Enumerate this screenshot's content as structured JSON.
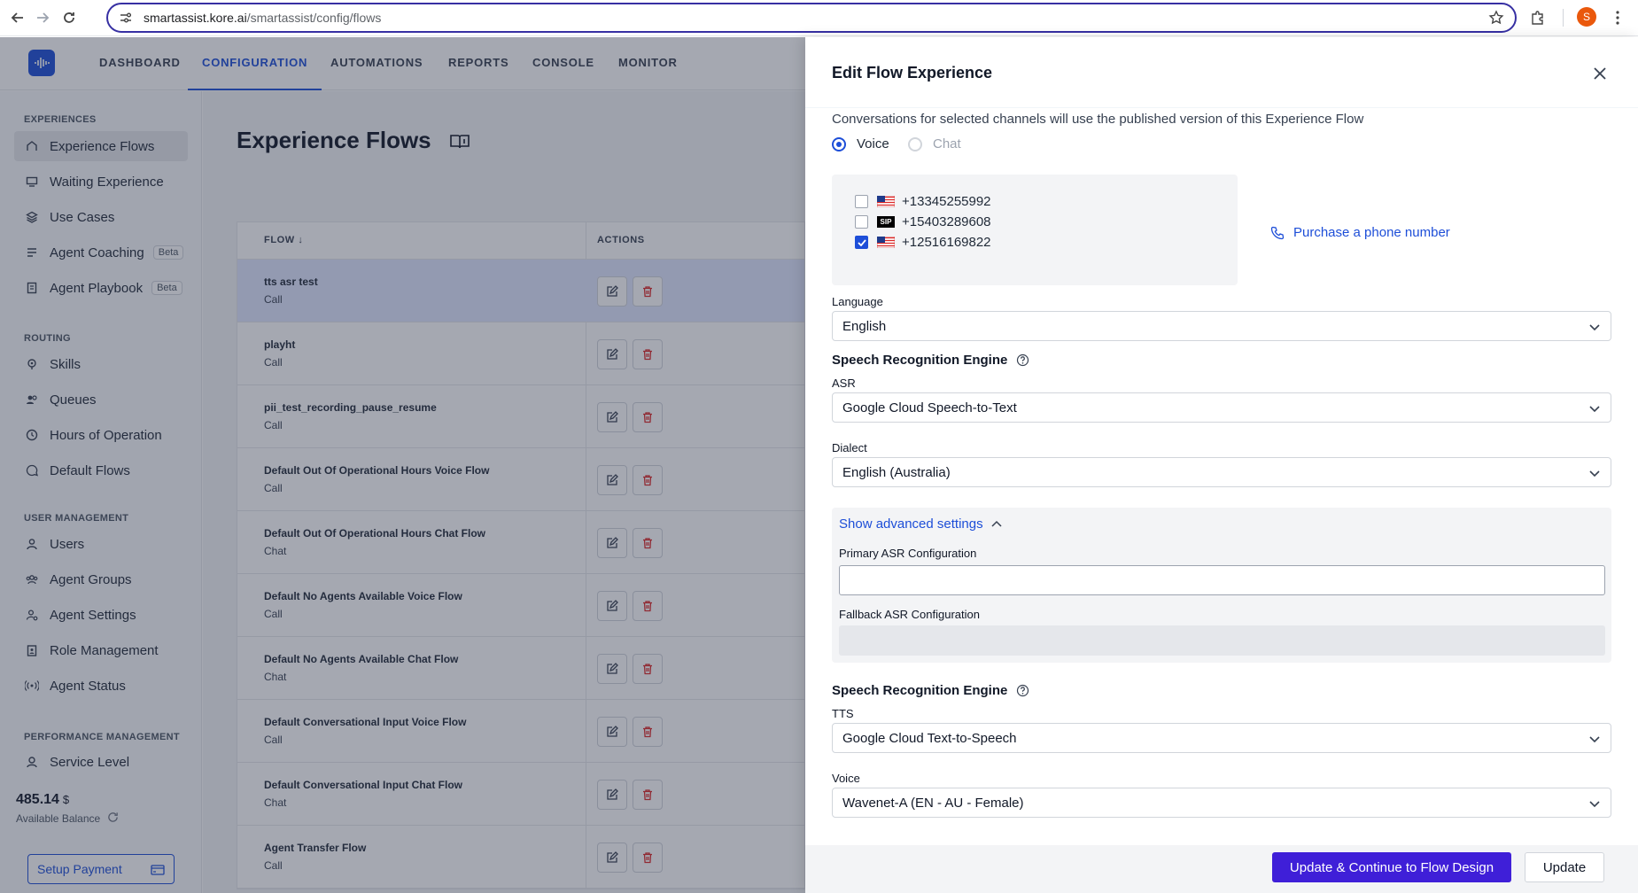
{
  "browser": {
    "url_host": "smartassist.kore.ai",
    "url_path": "/smartassist/config/flows",
    "profile_initial": "S"
  },
  "nav": {
    "items": [
      "DASHBOARD",
      "CONFIGURATION",
      "AUTOMATIONS",
      "REPORTS",
      "CONSOLE",
      "MONITOR"
    ],
    "active": "CONFIGURATION"
  },
  "sidebar": {
    "sections": {
      "experiences": "EXPERIENCES",
      "routing": "ROUTING",
      "user_management": "USER MANAGEMENT",
      "performance_management": "PERFORMANCE MANAGEMENT"
    },
    "items": [
      {
        "label": "Experience Flows",
        "icon": "flow-icon",
        "active": true
      },
      {
        "label": "Waiting Experience",
        "icon": "monitor-icon"
      },
      {
        "label": "Use Cases",
        "icon": "layers-icon"
      },
      {
        "label": "Agent Coaching",
        "icon": "coaching-icon",
        "badge": "Beta"
      },
      {
        "label": "Agent Playbook",
        "icon": "playbook-icon",
        "badge": "Beta"
      },
      {
        "label": "Skills",
        "icon": "pin-icon"
      },
      {
        "label": "Queues",
        "icon": "users-icon"
      },
      {
        "label": "Hours of Operation",
        "icon": "clock-icon"
      },
      {
        "label": "Default Flows",
        "icon": "chat-icon"
      },
      {
        "label": "Users",
        "icon": "user-icon"
      },
      {
        "label": "Agent Groups",
        "icon": "group-icon"
      },
      {
        "label": "Agent Settings",
        "icon": "user-settings-icon"
      },
      {
        "label": "Role Management",
        "icon": "clipboard-icon"
      },
      {
        "label": "Agent Status",
        "icon": "broadcast-icon"
      },
      {
        "label": "Service Level",
        "icon": "badge-icon"
      }
    ],
    "balance": {
      "amount": "485.14",
      "currency": "$",
      "label": "Available Balance"
    },
    "setup_payment": "Setup Payment"
  },
  "main": {
    "title": "Experience Flows",
    "table": {
      "col_flow": "FLOW ↓",
      "col_actions": "ACTIONS",
      "rows": [
        {
          "name": "tts asr test",
          "type": "Call"
        },
        {
          "name": "playht",
          "type": "Call"
        },
        {
          "name": "pii_test_recording_pause_resume",
          "type": "Call"
        },
        {
          "name": "Default Out Of Operational Hours Voice Flow",
          "type": "Call"
        },
        {
          "name": "Default Out Of Operational Hours Chat Flow",
          "type": "Chat"
        },
        {
          "name": "Default No Agents Available Voice Flow",
          "type": "Call"
        },
        {
          "name": "Default No Agents Available Chat Flow",
          "type": "Chat"
        },
        {
          "name": "Default Conversational Input Voice Flow",
          "type": "Call"
        },
        {
          "name": "Default Conversational Input Chat Flow",
          "type": "Chat"
        },
        {
          "name": "Agent Transfer Flow",
          "type": "Call"
        }
      ]
    }
  },
  "drawer": {
    "title": "Edit Flow Experience",
    "description": "Conversations for selected channels will use the published version of this Experience Flow",
    "channel_voice": "Voice",
    "channel_chat": "Chat",
    "numbers": [
      {
        "number": "+13345255992",
        "flag": "us-flag-icon",
        "checked": false
      },
      {
        "number": "+15403289608",
        "flag": "sip-icon",
        "sip_label": "SIP",
        "checked": false
      },
      {
        "number": "+12516169822",
        "flag": "us-flag-icon",
        "checked": true
      }
    ],
    "purchase_link": "Purchase a phone number",
    "language_label": "Language",
    "language_value": "English",
    "sre_title": "Speech Recognition Engine",
    "asr_label": "ASR",
    "asr_value": "Google Cloud Speech-to-Text",
    "dialect_label": "Dialect",
    "dialect_value": "English (Australia)",
    "advanced_toggle": "Show advanced settings",
    "primary_asr_label": "Primary ASR Configuration",
    "primary_asr_value": "",
    "fallback_asr_label": "Fallback ASR Configuration",
    "sre2_title": "Speech Recognition Engine",
    "tts_label": "TTS",
    "tts_value": "Google Cloud Text-to-Speech",
    "voice_label": "Voice",
    "voice_value": "Wavenet-A (EN - AU - Female)",
    "btn_continue": "Update & Continue to Flow Design",
    "btn_update": "Update"
  },
  "colors": {
    "accent": "#1d4ed8",
    "primary_button": "#3f1fd8",
    "selected_row": "#e0e7ff",
    "delete_icon": "#dc2626"
  }
}
